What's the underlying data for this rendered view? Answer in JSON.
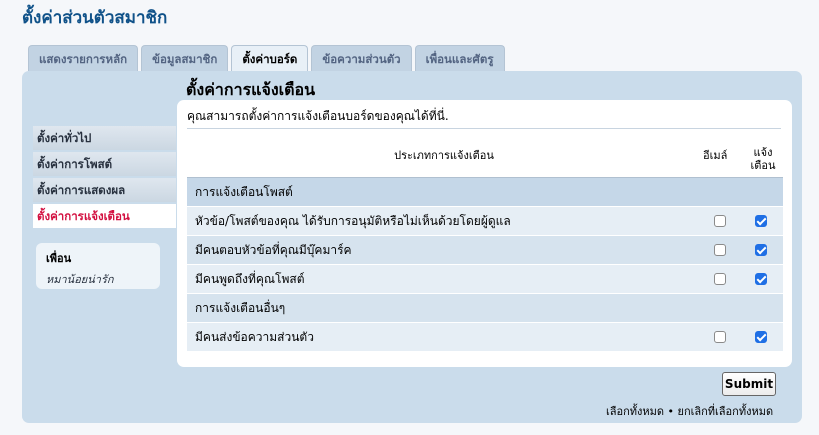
{
  "page": {
    "title": "ตั้งค่าส่วนตัวสมาชิก"
  },
  "tabs": [
    {
      "label": "แสดงรายการหลัก"
    },
    {
      "label": "ข้อมูลสมาชิก"
    },
    {
      "label": "ตั้งค่าบอร์ด"
    },
    {
      "label": "ข้อความส่วนตัว"
    },
    {
      "label": "เพื่อนและศัตรู"
    }
  ],
  "section": {
    "title": "ตั้งค่าการแจ้งเตือน",
    "intro": "คุณสามารถตั้งค่าการแจ้งเตือนบอร์ดของคุณได้ที่นี่."
  },
  "sidebar": {
    "items": [
      {
        "label": "ตั้งค่าทั่วไป"
      },
      {
        "label": "ตั้งค่าการโพสต์"
      },
      {
        "label": "ตั้งค่าการแสดงผล"
      },
      {
        "label": "ตั้งค่าการแจ้งเตือน"
      }
    ],
    "friends": {
      "title": "เพื่อน",
      "name": "หมาน้อยน่ารัก"
    }
  },
  "table": {
    "headers": {
      "type": "ประเภทการแจ้งเตือน",
      "email": "อีเมล์",
      "notify": "แจ้งเตือน"
    },
    "rows": [
      {
        "label": "การแจ้งเตือนโพสต์"
      },
      {
        "label": "หัวข้อ/โพสต์ของคุณ ได้รับการอนุมัติหรือไม่เห็นด้วยโดยผู้ดูแล"
      },
      {
        "label": "มีคนตอบหัวข้อที่คุณมีบุ๊คมาร์ค"
      },
      {
        "label": "มีคนพูดถึงที่คุณโพสต์"
      },
      {
        "label": "การแจ้งเตือนอื่นๆ"
      },
      {
        "label": "มีคนส่งข้อความส่วนตัว"
      }
    ]
  },
  "form": {
    "submit": "Submit",
    "select_all": "เลือกทั้งหมด",
    "separator": " • ",
    "deselect_all": "ยกเลิกที่เลือกทั้งหมด"
  }
}
